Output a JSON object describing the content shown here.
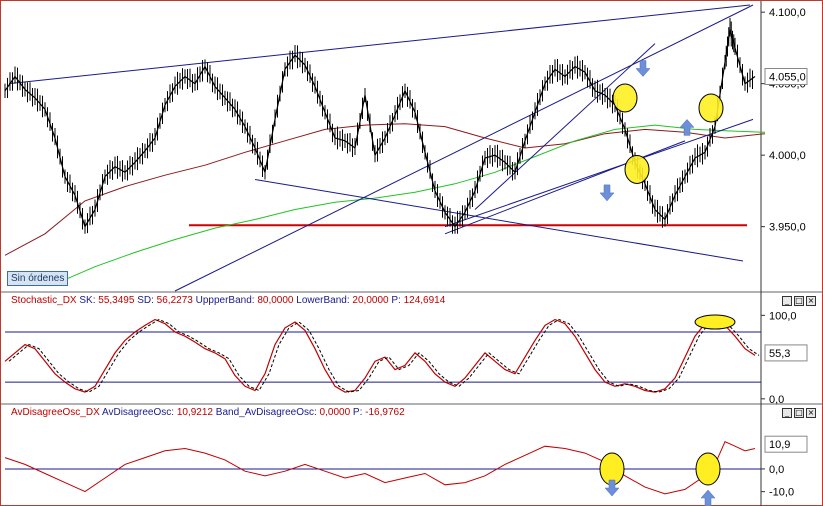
{
  "chart_data": [
    {
      "type": "line",
      "ylim": [
        3905,
        4105
      ],
      "ticks": [
        "4.100,0",
        "4.050,0",
        "4.000,0",
        "3.950,0"
      ],
      "tick_values": [
        4100,
        4050,
        4000,
        3950
      ],
      "last_value": "4.055,0",
      "horizontal_line": 3951,
      "ma_slow": [
        [
          0,
          3930
        ],
        [
          40,
          3945
        ],
        [
          80,
          3968
        ],
        [
          120,
          3978
        ],
        [
          160,
          3986
        ],
        [
          200,
          3993
        ],
        [
          240,
          4002
        ],
        [
          280,
          4010
        ],
        [
          320,
          4018
        ],
        [
          360,
          4021
        ],
        [
          400,
          4022
        ],
        [
          440,
          4020
        ],
        [
          480,
          4012
        ],
        [
          520,
          4005
        ],
        [
          560,
          4008
        ],
        [
          600,
          4015
        ],
        [
          640,
          4018
        ],
        [
          680,
          4016
        ],
        [
          720,
          4012
        ],
        [
          760,
          4015
        ]
      ],
      "ma_fast": [
        [
          50,
          3910
        ],
        [
          90,
          3922
        ],
        [
          130,
          3932
        ],
        [
          170,
          3941
        ],
        [
          210,
          3949
        ],
        [
          250,
          3955
        ],
        [
          290,
          3962
        ],
        [
          330,
          3967
        ],
        [
          370,
          3970
        ],
        [
          410,
          3974
        ],
        [
          450,
          3980
        ],
        [
          490,
          3988
        ],
        [
          530,
          3999
        ],
        [
          570,
          4010
        ],
        [
          610,
          4018
        ],
        [
          650,
          4021
        ],
        [
          690,
          4018
        ],
        [
          720,
          4017
        ],
        [
          760,
          4016
        ]
      ],
      "price": [
        [
          0,
          4045
        ],
        [
          10,
          4055
        ],
        [
          20,
          4046
        ],
        [
          30,
          4040
        ],
        [
          40,
          4032
        ],
        [
          50,
          4012
        ],
        [
          60,
          3985
        ],
        [
          70,
          3972
        ],
        [
          80,
          3950
        ],
        [
          90,
          3962
        ],
        [
          100,
          3985
        ],
        [
          110,
          3992
        ],
        [
          120,
          3988
        ],
        [
          130,
          3995
        ],
        [
          140,
          4003
        ],
        [
          150,
          4012
        ],
        [
          160,
          4035
        ],
        [
          170,
          4048
        ],
        [
          180,
          4055
        ],
        [
          190,
          4050
        ],
        [
          200,
          4062
        ],
        [
          210,
          4048
        ],
        [
          220,
          4040
        ],
        [
          230,
          4032
        ],
        [
          240,
          4020
        ],
        [
          250,
          4005
        ],
        [
          260,
          3988
        ],
        [
          270,
          4025
        ],
        [
          280,
          4060
        ],
        [
          290,
          4070
        ],
        [
          300,
          4063
        ],
        [
          310,
          4048
        ],
        [
          320,
          4030
        ],
        [
          330,
          4012
        ],
        [
          340,
          4010
        ],
        [
          350,
          4005
        ],
        [
          360,
          4042
        ],
        [
          370,
          4000
        ],
        [
          380,
          4012
        ],
        [
          390,
          4028
        ],
        [
          400,
          4045
        ],
        [
          410,
          4030
        ],
        [
          420,
          4002
        ],
        [
          430,
          3975
        ],
        [
          440,
          3960
        ],
        [
          450,
          3950
        ],
        [
          460,
          3960
        ],
        [
          470,
          3975
        ],
        [
          480,
          3998
        ],
        [
          490,
          4000
        ],
        [
          500,
          3995
        ],
        [
          510,
          3988
        ],
        [
          520,
          4010
        ],
        [
          530,
          4030
        ],
        [
          540,
          4050
        ],
        [
          550,
          4060
        ],
        [
          560,
          4055
        ],
        [
          570,
          4062
        ],
        [
          580,
          4058
        ],
        [
          590,
          4045
        ],
        [
          600,
          4042
        ],
        [
          610,
          4035
        ],
        [
          620,
          4018
        ],
        [
          630,
          3995
        ],
        [
          640,
          3980
        ],
        [
          650,
          3962
        ],
        [
          660,
          3955
        ],
        [
          670,
          3972
        ],
        [
          680,
          3985
        ],
        [
          690,
          3998
        ],
        [
          700,
          4002
        ],
        [
          710,
          4020
        ],
        [
          720,
          4065
        ],
        [
          725,
          4088
        ],
        [
          730,
          4075
        ],
        [
          740,
          4050
        ],
        [
          750,
          4055
        ]
      ]
    },
    {
      "type": "line",
      "ylim": [
        -5,
        110
      ],
      "ticks": [
        "100,0",
        "0,0"
      ],
      "tick_values": [
        100,
        0
      ],
      "bands": [
        80,
        20
      ],
      "last_value": "55,3",
      "values": [
        [
          0,
          45
        ],
        [
          10,
          55
        ],
        [
          20,
          65
        ],
        [
          30,
          60
        ],
        [
          40,
          45
        ],
        [
          50,
          30
        ],
        [
          60,
          20
        ],
        [
          70,
          12
        ],
        [
          80,
          8
        ],
        [
          90,
          15
        ],
        [
          100,
          35
        ],
        [
          110,
          55
        ],
        [
          120,
          70
        ],
        [
          130,
          80
        ],
        [
          140,
          88
        ],
        [
          150,
          95
        ],
        [
          160,
          90
        ],
        [
          170,
          80
        ],
        [
          180,
          75
        ],
        [
          190,
          68
        ],
        [
          200,
          60
        ],
        [
          210,
          55
        ],
        [
          220,
          48
        ],
        [
          230,
          28
        ],
        [
          240,
          15
        ],
        [
          250,
          10
        ],
        [
          260,
          30
        ],
        [
          270,
          65
        ],
        [
          280,
          85
        ],
        [
          290,
          92
        ],
        [
          300,
          82
        ],
        [
          310,
          60
        ],
        [
          320,
          35
        ],
        [
          330,
          15
        ],
        [
          340,
          8
        ],
        [
          350,
          10
        ],
        [
          360,
          25
        ],
        [
          370,
          45
        ],
        [
          380,
          50
        ],
        [
          390,
          35
        ],
        [
          400,
          40
        ],
        [
          410,
          55
        ],
        [
          420,
          45
        ],
        [
          430,
          30
        ],
        [
          440,
          20
        ],
        [
          450,
          15
        ],
        [
          460,
          25
        ],
        [
          470,
          40
        ],
        [
          480,
          55
        ],
        [
          490,
          45
        ],
        [
          500,
          35
        ],
        [
          510,
          30
        ],
        [
          520,
          50
        ],
        [
          530,
          70
        ],
        [
          540,
          88
        ],
        [
          550,
          95
        ],
        [
          560,
          90
        ],
        [
          570,
          75
        ],
        [
          580,
          55
        ],
        [
          590,
          35
        ],
        [
          600,
          20
        ],
        [
          610,
          15
        ],
        [
          620,
          18
        ],
        [
          630,
          15
        ],
        [
          640,
          10
        ],
        [
          650,
          8
        ],
        [
          660,
          12
        ],
        [
          670,
          25
        ],
        [
          680,
          50
        ],
        [
          690,
          75
        ],
        [
          700,
          90
        ],
        [
          710,
          92
        ],
        [
          720,
          88
        ],
        [
          730,
          75
        ],
        [
          740,
          60
        ],
        [
          750,
          52
        ]
      ]
    },
    {
      "type": "line",
      "ylim": [
        -15,
        22
      ],
      "ticks": [
        "0,0",
        "-10,0"
      ],
      "tick_values": [
        0,
        -10
      ],
      "zero_line": 0,
      "last_value": "10,9",
      "values": [
        [
          0,
          5
        ],
        [
          20,
          2
        ],
        [
          40,
          -2
        ],
        [
          60,
          -6
        ],
        [
          80,
          -10
        ],
        [
          100,
          -4
        ],
        [
          120,
          2
        ],
        [
          140,
          5
        ],
        [
          160,
          8
        ],
        [
          180,
          9
        ],
        [
          200,
          7
        ],
        [
          220,
          4
        ],
        [
          240,
          -1
        ],
        [
          260,
          -3
        ],
        [
          280,
          -1
        ],
        [
          300,
          2
        ],
        [
          320,
          -1
        ],
        [
          340,
          -4
        ],
        [
          360,
          -2
        ],
        [
          380,
          -6
        ],
        [
          400,
          -4
        ],
        [
          420,
          -2
        ],
        [
          440,
          -7
        ],
        [
          460,
          -6
        ],
        [
          480,
          -3
        ],
        [
          500,
          2
        ],
        [
          520,
          6
        ],
        [
          540,
          10
        ],
        [
          560,
          9
        ],
        [
          580,
          7
        ],
        [
          600,
          3
        ],
        [
          620,
          -3
        ],
        [
          640,
          -8
        ],
        [
          660,
          -11
        ],
        [
          680,
          -9
        ],
        [
          700,
          -3
        ],
        [
          710,
          2
        ],
        [
          720,
          12
        ],
        [
          730,
          10
        ],
        [
          740,
          8
        ],
        [
          750,
          9
        ]
      ]
    }
  ],
  "panels": {
    "p1_status": "Sin órdenes",
    "p2": {
      "name": "Stochastic_DX",
      "sk_label": "SK:",
      "sk_value": "55,3495",
      "sd_label": "SD:",
      "sd_value": "56,2273",
      "ub_label": "UppperBand:",
      "ub_value": "80,0000",
      "lb_label": "LowerBand:",
      "lb_value": "20,0000",
      "p_label": "P:",
      "p_value": "124,6914"
    },
    "p3": {
      "name": "AvDisagreeOsc_DX",
      "a_label": "AvDisagreeOsc:",
      "a_value": "10,9212",
      "b_label": "Band_AvDisagreeOsc:",
      "b_value": "0,0000",
      "p_label": "P:",
      "p_value": "-16,9762"
    },
    "buttons": [
      "_",
      "□",
      "×"
    ]
  },
  "colors": {
    "price": "#000000",
    "ma_slow": "#8b1a1a",
    "ma_fast": "#22c422",
    "trend": "#1a1a8c",
    "support": "#d00000",
    "highlight": "#ffee22",
    "arrow": "#6d8fd8",
    "stoch": "#c00000",
    "band": "#1a1a8c"
  }
}
